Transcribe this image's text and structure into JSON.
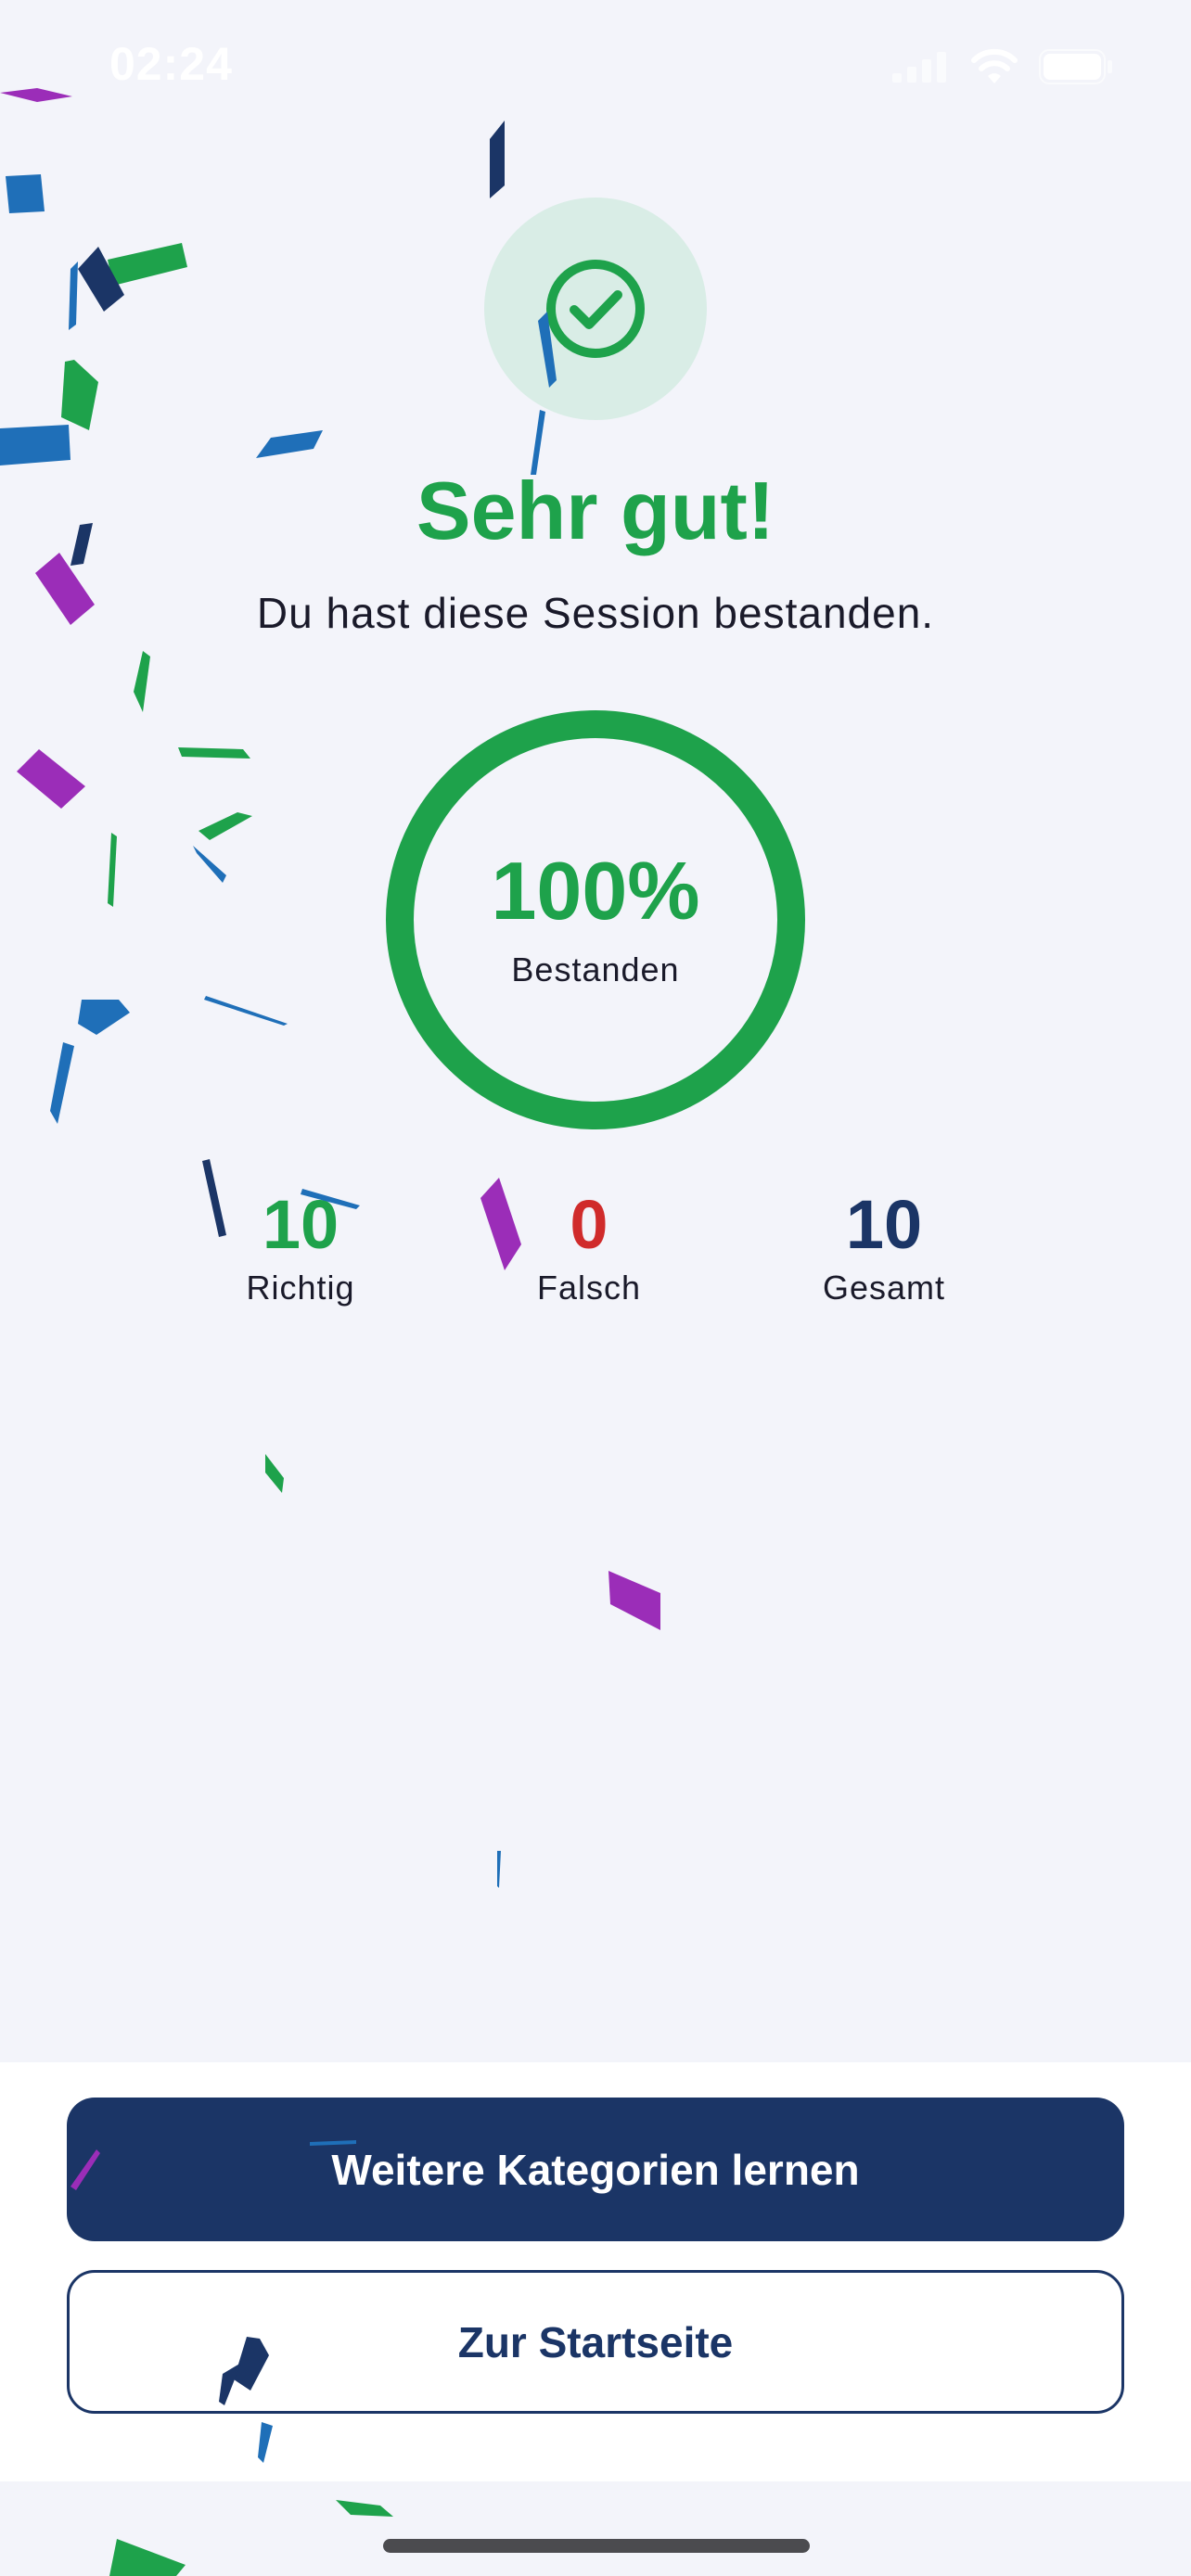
{
  "status_bar": {
    "time": "02:24",
    "icons": [
      "cellular-signal-icon",
      "wifi-icon",
      "battery-icon"
    ]
  },
  "result": {
    "icon": "check-circle-icon",
    "title": "Sehr gut!",
    "subtitle": "Du hast diese Session bestanden."
  },
  "progress": {
    "percent_text": "100%",
    "percent_value": 100,
    "label": "Bestanden"
  },
  "stats": {
    "correct": {
      "value": "10",
      "label": "Richtig"
    },
    "wrong": {
      "value": "0",
      "label": "Falsch"
    },
    "total": {
      "value": "10",
      "label": "Gesamt"
    }
  },
  "actions": {
    "primary_label": "Weitere Kategorien lernen",
    "secondary_label": "Zur Startseite"
  },
  "colors": {
    "success": "#1ea24b",
    "error": "#d02b2b",
    "navy": "#1b3566",
    "background": "#f3f4fa",
    "confetti_purple": "#9b2db8",
    "confetti_blue": "#1f6fb8"
  }
}
